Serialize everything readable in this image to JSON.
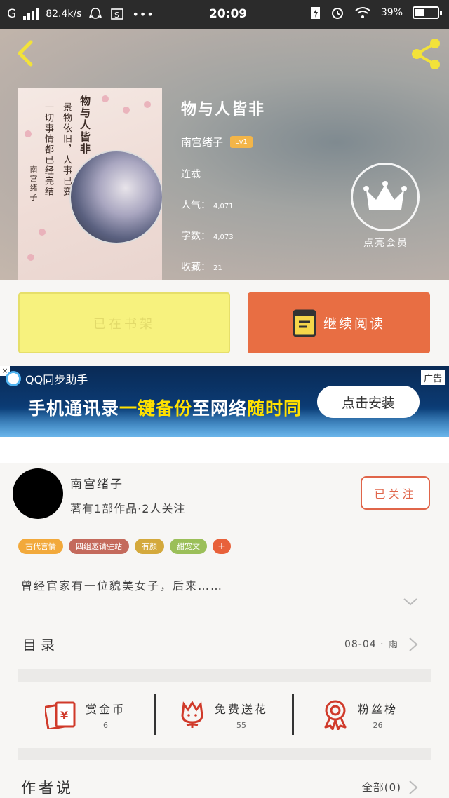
{
  "status_bar": {
    "carrier": "G",
    "speed": "82.4k/s",
    "time": "20:09",
    "battery": "39",
    "battery_level": 0.39
  },
  "book": {
    "title": "物与人皆非",
    "author": "南宫绪子",
    "level": "Lv1",
    "status": "连载",
    "popularity_label": "人气：",
    "popularity": "4,071",
    "words_label": "字数：",
    "words": "4,073",
    "favorites_label": "收藏：",
    "favorites": "21",
    "cover_lines": [
      "物与人皆非",
      "景物依旧，人事已变",
      "一切事情都已经完结",
      "南宫绪子"
    ]
  },
  "vip": {
    "label": "点亮会员"
  },
  "actions": {
    "shelf_label": "已在书架",
    "read_label": "继续阅读"
  },
  "ad": {
    "brand": "QQ同步助手",
    "tag": "广告",
    "headline_1": "手机通讯录",
    "headline_2": "一键备份",
    "headline_3": "至网络",
    "headline_4": "随时同",
    "install_label": "点击安装"
  },
  "author": {
    "name": "南宫绪子",
    "stats": "著有1部作品·2人关注",
    "follow_label": "已关注"
  },
  "tags": [
    {
      "label": "古代言情",
      "color": "#f2a93b"
    },
    {
      "label": "四组邀请驻站",
      "color": "#c46a5c"
    },
    {
      "label": "有颜",
      "color": "#d4a93c"
    },
    {
      "label": "甜宠文",
      "color": "#9bbf59"
    }
  ],
  "tag_plus": "+",
  "intro": "曾经官家有一位貌美女子，后来……",
  "toc": {
    "title": "目录",
    "update": "08-04 · 雨"
  },
  "rewards": [
    {
      "label": "赏金币",
      "count": "6",
      "icon": "red-envelope-icon"
    },
    {
      "label": "免费送花",
      "count": "55",
      "icon": "flower-icon"
    },
    {
      "label": "粉丝榜",
      "count": "26",
      "icon": "medal-icon"
    }
  ],
  "author_says": {
    "title": "作者说",
    "all_label": "全部(0)"
  },
  "colors": {
    "accent": "#e86e43",
    "shelf": "#f7f27e",
    "follow": "#e0654a",
    "icon_red": "#d03a2a"
  }
}
